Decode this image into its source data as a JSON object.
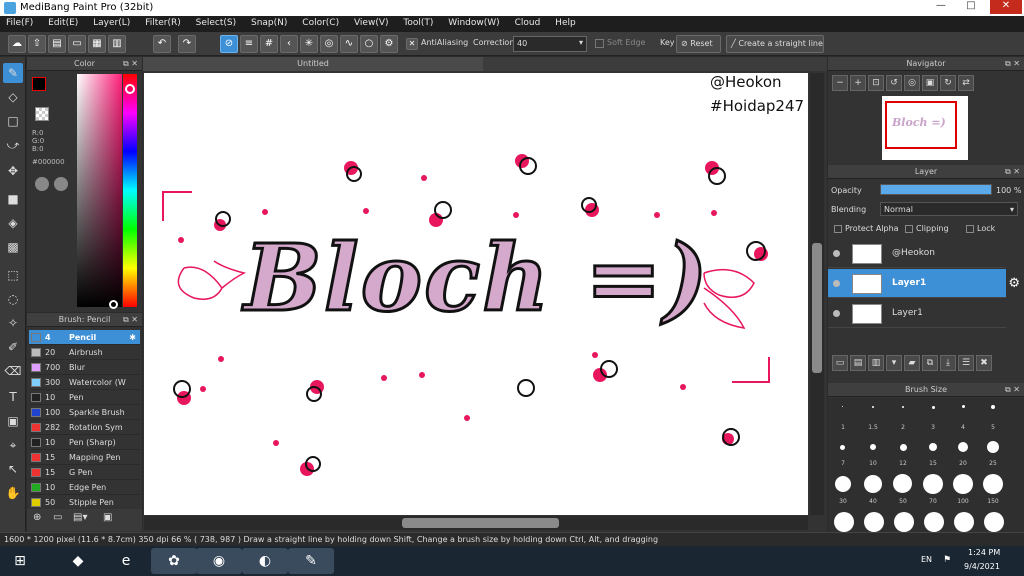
{
  "window": {
    "title": "MediBang Paint Pro (32bit)",
    "minimize": "—",
    "maximize": "□",
    "close": "✕"
  },
  "menu": [
    "File(F)",
    "Edit(E)",
    "Layer(L)",
    "Filter(R)",
    "Select(S)",
    "Snap(N)",
    "Color(C)",
    "View(V)",
    "Tool(T)",
    "Window(W)",
    "Cloud",
    "Help"
  ],
  "toolbar": {
    "antialiasing": "AntiAliasing",
    "correction_label": "Correction",
    "correction_value": "40",
    "soft_edge": "Soft Edge",
    "key": "Key",
    "reset": "Reset",
    "straight_line": "Create a straight line"
  },
  "color_panel": {
    "title": "Color",
    "r": "R:0",
    "g": "G:0",
    "b": "B:0",
    "hex": "#000000"
  },
  "brush_panel": {
    "title": "Brush: Pencil",
    "items": [
      {
        "size": "4",
        "name": "Pencil",
        "color": "#3d8fd6"
      },
      {
        "size": "20",
        "name": "Airbrush",
        "color": "#bbbbbb"
      },
      {
        "size": "700",
        "name": "Blur",
        "color": "#e0a0ff"
      },
      {
        "size": "300",
        "name": "Watercolor (W",
        "color": "#80d0ff"
      },
      {
        "size": "10",
        "name": "Pen",
        "color": "#222222"
      },
      {
        "size": "100",
        "name": "Sparkle Brush",
        "color": "#2244cc"
      },
      {
        "size": "282",
        "name": "Rotation Sym",
        "color": "#ee3333"
      },
      {
        "size": "10",
        "name": "Pen (Sharp)",
        "color": "#222222"
      },
      {
        "size": "15",
        "name": "Mapping Pen",
        "color": "#ee3333"
      },
      {
        "size": "15",
        "name": "G Pen",
        "color": "#ee3333"
      },
      {
        "size": "10",
        "name": "Edge Pen",
        "color": "#22aa22"
      },
      {
        "size": "50",
        "name": "Stipple Pen",
        "color": "#ddcc00"
      }
    ]
  },
  "document": {
    "tab": "Untitled",
    "watermark1": "@Heokon",
    "watermark2": "#Hoidap247",
    "artwork_text": "Bloch =)"
  },
  "navigator": {
    "title": "Navigator",
    "preview_text": "Bloch =)"
  },
  "layer_panel": {
    "title": "Layer",
    "opacity_label": "Opacity",
    "opacity_value": "100 %",
    "opacity_level": 1.0,
    "blending_label": "Blending",
    "blending_value": "Normal",
    "protect_alpha": "Protect Alpha",
    "clipping": "Clipping",
    "lock": "Lock",
    "layers": [
      {
        "name": "@Heokon"
      },
      {
        "name": "Layer1"
      },
      {
        "name": "Layer1"
      }
    ]
  },
  "brush_size_panel": {
    "title": "Brush Size",
    "row1": [
      "1",
      "1.5",
      "2",
      "3",
      "4",
      "5"
    ],
    "row2": [
      "7",
      "10",
      "12",
      "15",
      "20",
      "25"
    ],
    "row3": [
      "30",
      "40",
      "50",
      "70",
      "100",
      "150"
    ]
  },
  "statusbar": {
    "text": "1600 * 1200 pixel   (11.6 * 8.7cm)   350 dpi   66 %   ( 738, 987 )   Draw a straight line by holding down Shift, Change a brush size by holding down Ctrl, Alt, and dragging"
  },
  "taskbar": {
    "lang": "EN",
    "time": "1:24 PM",
    "date": "9/4/2021"
  },
  "colors": {
    "accent": "#3d8fd6",
    "pink": "#e8175d",
    "lettering": "#c9a3c9"
  }
}
